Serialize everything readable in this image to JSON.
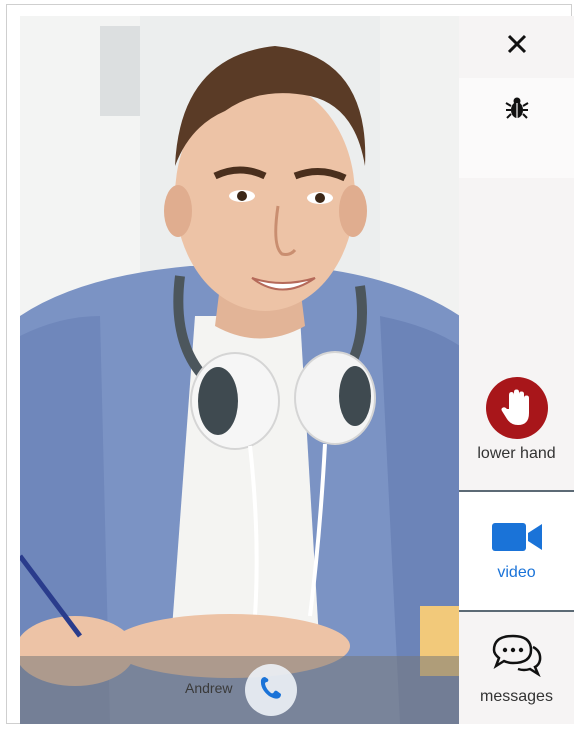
{
  "caller": {
    "name": "Andrew"
  },
  "sidebar": {
    "close_icon": "close-icon",
    "bug_icon": "bug-icon",
    "hand": {
      "label": "lower hand",
      "icon": "hand-icon",
      "color": "#a8161a"
    },
    "video": {
      "label": "video",
      "icon": "video-camera-icon",
      "color": "#1a73d8"
    },
    "messages": {
      "label": "messages",
      "icon": "chat-bubbles-icon"
    }
  },
  "call": {
    "icon": "phone-icon",
    "color": "#1a73d8"
  }
}
